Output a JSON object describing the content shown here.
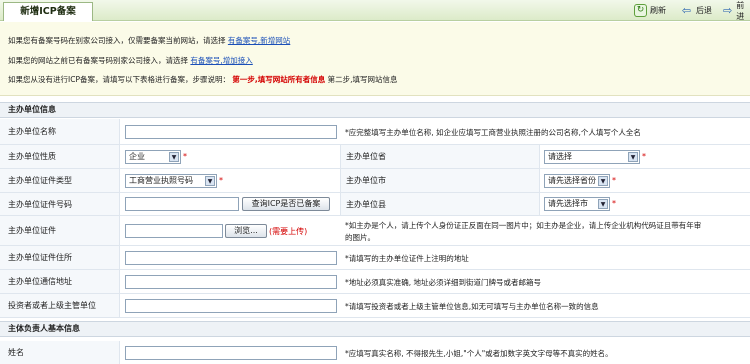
{
  "tab": {
    "title": "新增ICP备案"
  },
  "toolbar": {
    "refresh": "刷新",
    "back": "后退",
    "forward": "前进"
  },
  "info": {
    "line1_text": "如果您有备案号码在别家公司接入，仅需要备案当前网站，请选择",
    "line1_link": "有备案号,新增网站",
    "line2_text": "如果您的网站之前已有备案号码别家公司接入，请选择",
    "line2_link": "有备案号,增加接入",
    "line3_text": "如果您从没有进行ICP备案，请填写以下表格进行备案，步骤说明：",
    "line3_step1": "第一步,填写网站所有者信息",
    "line3_step2": "第二步,填写网站信息"
  },
  "sections": {
    "host": "主办单位信息",
    "person": "主体负责人基本信息"
  },
  "form": {
    "name_label": "主办单位名称",
    "name_hint": "*应完整填写主办单位名称, 如企业应填写工商营业执照注册的公司名称,个人填写个人全名",
    "nature_label": "主办单位性质",
    "nature_value": "企业",
    "province_label": "主办单位省",
    "province_value": "请选择",
    "cert_type_label": "主办单位证件类型",
    "cert_type_value": "工商营业执照号码",
    "city_label": "主办单位市",
    "city_value": "请先选择省份",
    "cert_no_label": "主办单位证件号码",
    "check_button": "查询ICP是否已备案",
    "county_label": "主办单位县",
    "county_value": "请先选择市",
    "cert_file_label": "主办单位证件",
    "browse_button": "浏览...",
    "need_upload": "(需要上传)",
    "cert_file_hint1": "*如主办是个人，请上传个人身份证正反面在同一图片中；如主办是企业，请上传企业机构代码证且带有年审",
    "cert_file_hint2": "的图片。",
    "addr_label": "主办单位证件住所",
    "addr_hint": "*请填写的主办单位证件上注明的地址",
    "mail_label": "主办单位通信地址",
    "mail_hint": "*地址必须真实准确, 地址必须详细到街道门牌号或者邮箱号",
    "investor_label": "投资者或者上级主管单位",
    "investor_hint": "*请填写投资者或者上级主管单位信息,如无可填写与主办单位名称一致的信息",
    "person_name_label": "姓名",
    "person_name_hint": "*应填写真实名称, 不得报先生,小姐,\"个人\"或者加数字英文字母等不真实的姓名。"
  },
  "colors": {
    "accent_red": "#d40000",
    "link_blue": "#1a4fb8",
    "tab_green": "#dcebc9"
  }
}
